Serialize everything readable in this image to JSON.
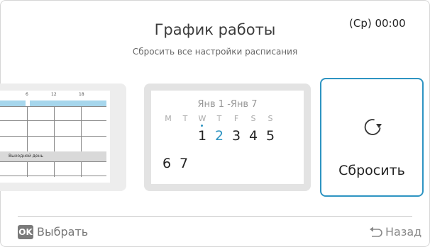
{
  "header": {
    "title": "График работы",
    "subtitle": "Сбросить все настройки расписания",
    "clock": "(Ср) 00:00"
  },
  "schedule_preview": {
    "tick_labels": [
      "6",
      "12",
      "18"
    ],
    "day_off_label": "Выходной день"
  },
  "calendar": {
    "range": "Янв 1 -Янв 7",
    "weekdays": [
      "M",
      "T",
      "W",
      "T",
      "F",
      "S",
      "S"
    ],
    "week1": [
      "1",
      "2",
      "3",
      "4",
      "5"
    ],
    "week2": [
      "6",
      "7"
    ]
  },
  "reset_card": {
    "icon": "reset-icon",
    "label": "Сбросить"
  },
  "footer": {
    "ok_badge": "OK",
    "select_label": "Выбрать",
    "back_label": "Назад",
    "back_icon": "back-arrow-icon"
  },
  "colors": {
    "accent": "#2e94c2",
    "schedule_bar": "#a6d6ec",
    "card_bg": "#e3e3e3"
  }
}
